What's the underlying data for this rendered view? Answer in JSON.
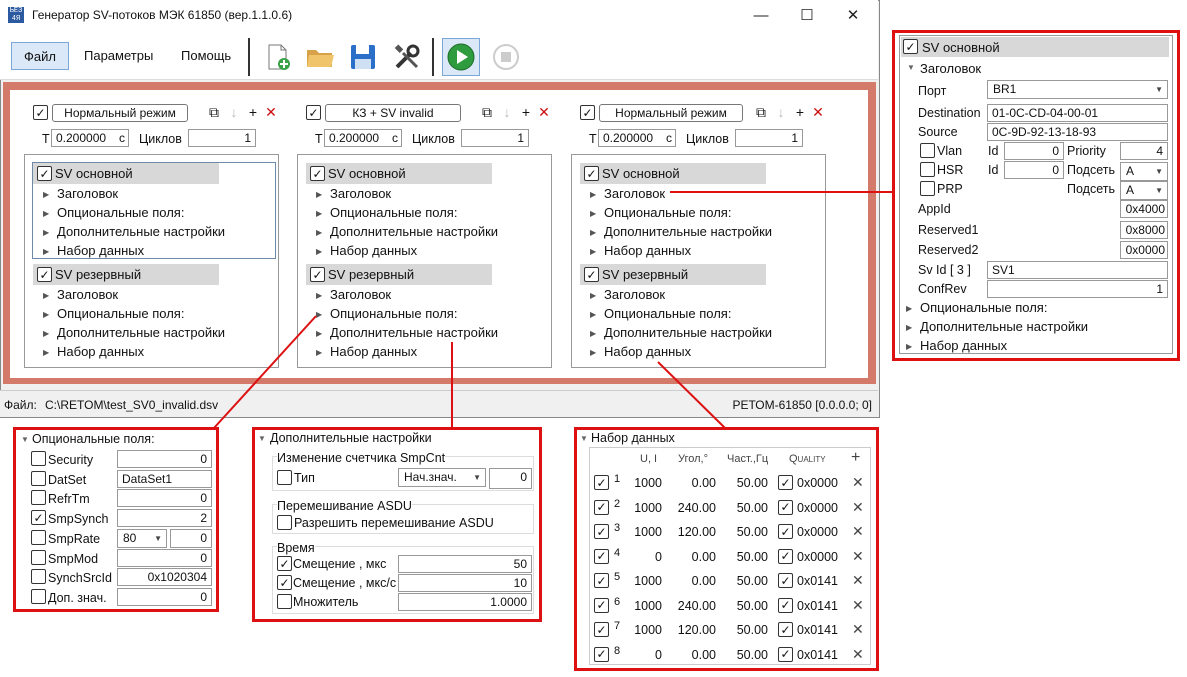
{
  "window": {
    "title": "Генератор SV-потоков МЭК 61850 (вер.1.1.0.6)",
    "icon_text": "ЬЕЗ 4Я",
    "minimize": "—",
    "maximize": "☐",
    "close": "✕"
  },
  "menu": {
    "file": "Файл",
    "params": "Параметры",
    "help": "Помощь"
  },
  "streams": [
    {
      "mode": "Нормальный режим",
      "t_label": "T",
      "t_value": "0.200000",
      "t_unit": "с",
      "cycles_label": "Циклов",
      "cycles_value": "1",
      "primary": "SV основной",
      "reserve": "SV резервный",
      "items": [
        "Заголовок",
        "Опциональные поля:",
        "Дополнительные настройки",
        "Набор данных"
      ]
    },
    {
      "mode": "КЗ + SV invalid",
      "t_label": "T",
      "t_value": "0.200000",
      "t_unit": "с",
      "cycles_label": "Циклов",
      "cycles_value": "1",
      "primary": "SV основной",
      "reserve": "SV резервный",
      "items": [
        "Заголовок",
        "Опциональные поля:",
        "Дополнительные настройки",
        "Набор данных"
      ]
    },
    {
      "mode": "Нормальный режим",
      "t_label": "T",
      "t_value": "0.200000",
      "t_unit": "с",
      "cycles_label": "Циклов",
      "cycles_value": "1",
      "primary": "SV основной",
      "reserve": "SV резервный",
      "items": [
        "Заголовок",
        "Опциональные поля:",
        "Дополнительные настройки",
        "Набор данных"
      ]
    }
  ],
  "status": {
    "file_label": "Файл:",
    "file_path": "C:\\RETOM\\test_SV0_invalid.dsv",
    "device": "РЕТОМ-61850 [0.0.0.0; 0]"
  },
  "header_panel": {
    "title": "SV основной",
    "section": "Заголовок",
    "port_label": "Порт",
    "port_value": "BR1",
    "dest_label": "Destination",
    "dest_value": "01-0C-CD-04-00-01",
    "source_label": "Source",
    "source_value": "0C-9D-92-13-18-93",
    "vlan_label": "Vlan",
    "vlan_id_label": "Id",
    "vlan_id": "0",
    "priority_label": "Priority",
    "priority": "4",
    "hsr_label": "HSR",
    "hsr_id_label": "Id",
    "hsr_id": "0",
    "hsr_sub_label": "Подсеть",
    "hsr_sub": "A",
    "prp_label": "PRP",
    "prp_sub_label": "Подсеть",
    "prp_sub": "A",
    "appid_label": "AppId",
    "appid": "0x4000",
    "res1_label": "Reserved1",
    "res1": "0x8000",
    "res2_label": "Reserved2",
    "res2": "0x0000",
    "svid_label": "Sv Id [ 3 ]",
    "svid": "SV1",
    "confrev_label": "ConfRev",
    "confrev": "1",
    "more": [
      "Опциональные поля:",
      "Дополнительные настройки",
      "Набор данных"
    ]
  },
  "optional_panel": {
    "title": "Опциональные поля:",
    "rows": [
      {
        "label": "Security",
        "value": "0",
        "checked": false
      },
      {
        "label": "DatSet",
        "value": "DataSet1",
        "checked": false
      },
      {
        "label": "RefrTm",
        "value": "0",
        "checked": false
      },
      {
        "label": "SmpSynch",
        "value": "2",
        "checked": true
      },
      {
        "label": "SmpRate",
        "value": "0",
        "checked": false,
        "select": "80"
      },
      {
        "label": "SmpMod",
        "value": "0",
        "checked": false
      },
      {
        "label": "SynchSrcId",
        "value": "0x1020304",
        "checked": false
      },
      {
        "label": "Доп. знач.",
        "value": "0",
        "checked": false
      }
    ]
  },
  "extra_panel": {
    "title": "Дополнительные настройки",
    "smpcnt_group": "Изменение счетчика SmpCnt",
    "type_label": "Тип",
    "type_select": "Нач.знач.",
    "type_value": "0",
    "asdu_group": "Перемешивание ASDU",
    "asdu_allow": "Разрешить перемешивание ASDU",
    "time_group": "Время",
    "offset_label": "Смещение , мкс",
    "offset_value": "50",
    "offset2_label": "Смещение , мкс/с",
    "offset2_value": "10",
    "mult_label": "Множитель",
    "mult_value": "1.0000"
  },
  "dataset_panel": {
    "title": "Набор данных",
    "headers": {
      "ui": "U, I",
      "angle": "Угол,°",
      "freq": "Част.,Гц",
      "quality": "Quality",
      "add": "+"
    },
    "rows": [
      {
        "n": "1",
        "u": "1000",
        "angle": "0.00",
        "freq": "50.00",
        "q": "0x0000"
      },
      {
        "n": "2",
        "u": "1000",
        "angle": "240.00",
        "freq": "50.00",
        "q": "0x0000"
      },
      {
        "n": "3",
        "u": "1000",
        "angle": "120.00",
        "freq": "50.00",
        "q": "0x0000"
      },
      {
        "n": "4",
        "u": "0",
        "angle": "0.00",
        "freq": "50.00",
        "q": "0x0000"
      },
      {
        "n": "5",
        "u": "1000",
        "angle": "0.00",
        "freq": "50.00",
        "q": "0x0141"
      },
      {
        "n": "6",
        "u": "1000",
        "angle": "240.00",
        "freq": "50.00",
        "q": "0x0141"
      },
      {
        "n": "7",
        "u": "1000",
        "angle": "120.00",
        "freq": "50.00",
        "q": "0x0141"
      },
      {
        "n": "8",
        "u": "0",
        "angle": "0.00",
        "freq": "50.00",
        "q": "0x0141"
      }
    ]
  }
}
